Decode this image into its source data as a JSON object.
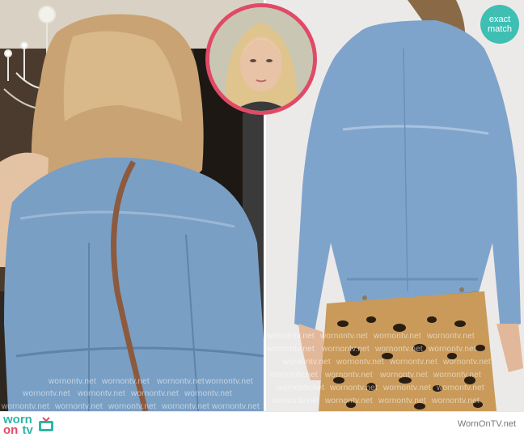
{
  "badge": {
    "line1": "exact",
    "line2": "match",
    "color": "#3fbfb4"
  },
  "footer": {
    "logo_worn": "worn",
    "logo_on": "on",
    "logo_tv": "tv",
    "site": "WornOnTV.net"
  },
  "watermark_text": "wornontv.net",
  "colors": {
    "inset_border": "#e04a67",
    "denim": "#7a9fc4",
    "brand_teal": "#2fb5a8",
    "brand_pink": "#e44a67"
  },
  "icons": [
    "tv-icon"
  ]
}
